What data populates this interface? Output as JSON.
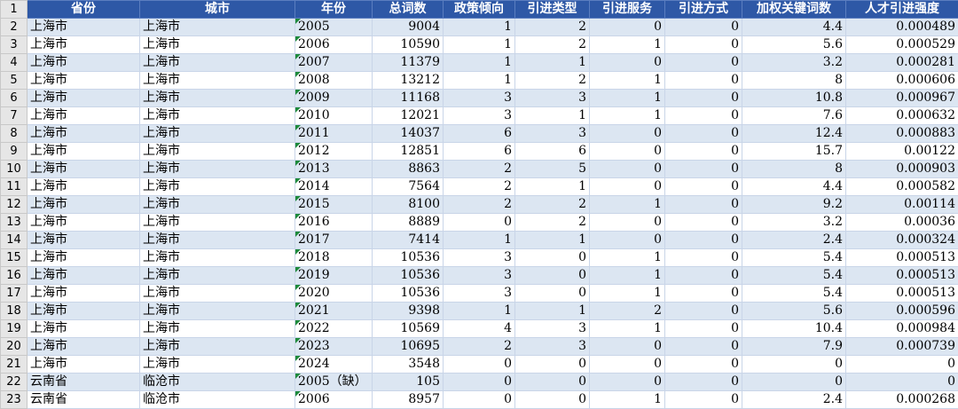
{
  "columns": [
    "省份",
    "城市",
    "年份",
    "总词数",
    "政策倾向",
    "引进类型",
    "引进服务",
    "引进方式",
    "加权关键词数",
    "人才引进强度"
  ],
  "header_row_number": "1",
  "rows": [
    {
      "n": "2",
      "province": "上海市",
      "city": "上海市",
      "year": "2005",
      "words": "9004",
      "tendency": "1",
      "type": "2",
      "service": "0",
      "method": "0",
      "weighted": "4.4",
      "intensity": "0.000489"
    },
    {
      "n": "3",
      "province": "上海市",
      "city": "上海市",
      "year": "2006",
      "words": "10590",
      "tendency": "1",
      "type": "2",
      "service": "1",
      "method": "0",
      "weighted": "5.6",
      "intensity": "0.000529"
    },
    {
      "n": "4",
      "province": "上海市",
      "city": "上海市",
      "year": "2007",
      "words": "11379",
      "tendency": "1",
      "type": "1",
      "service": "0",
      "method": "0",
      "weighted": "3.2",
      "intensity": "0.000281"
    },
    {
      "n": "5",
      "province": "上海市",
      "city": "上海市",
      "year": "2008",
      "words": "13212",
      "tendency": "1",
      "type": "2",
      "service": "1",
      "method": "0",
      "weighted": "8",
      "intensity": "0.000606"
    },
    {
      "n": "6",
      "province": "上海市",
      "city": "上海市",
      "year": "2009",
      "words": "11168",
      "tendency": "3",
      "type": "3",
      "service": "1",
      "method": "0",
      "weighted": "10.8",
      "intensity": "0.000967"
    },
    {
      "n": "7",
      "province": "上海市",
      "city": "上海市",
      "year": "2010",
      "words": "12021",
      "tendency": "3",
      "type": "1",
      "service": "1",
      "method": "0",
      "weighted": "7.6",
      "intensity": "0.000632"
    },
    {
      "n": "8",
      "province": "上海市",
      "city": "上海市",
      "year": "2011",
      "words": "14037",
      "tendency": "6",
      "type": "3",
      "service": "0",
      "method": "0",
      "weighted": "12.4",
      "intensity": "0.000883"
    },
    {
      "n": "9",
      "province": "上海市",
      "city": "上海市",
      "year": "2012",
      "words": "12851",
      "tendency": "6",
      "type": "6",
      "service": "0",
      "method": "0",
      "weighted": "15.7",
      "intensity": "0.00122"
    },
    {
      "n": "10",
      "province": "上海市",
      "city": "上海市",
      "year": "2013",
      "words": "8863",
      "tendency": "2",
      "type": "5",
      "service": "0",
      "method": "0",
      "weighted": "8",
      "intensity": "0.000903"
    },
    {
      "n": "11",
      "province": "上海市",
      "city": "上海市",
      "year": "2014",
      "words": "7564",
      "tendency": "2",
      "type": "1",
      "service": "0",
      "method": "0",
      "weighted": "4.4",
      "intensity": "0.000582"
    },
    {
      "n": "12",
      "province": "上海市",
      "city": "上海市",
      "year": "2015",
      "words": "8100",
      "tendency": "2",
      "type": "2",
      "service": "1",
      "method": "0",
      "weighted": "9.2",
      "intensity": "0.00114"
    },
    {
      "n": "13",
      "province": "上海市",
      "city": "上海市",
      "year": "2016",
      "words": "8889",
      "tendency": "0",
      "type": "2",
      "service": "0",
      "method": "0",
      "weighted": "3.2",
      "intensity": "0.00036"
    },
    {
      "n": "14",
      "province": "上海市",
      "city": "上海市",
      "year": "2017",
      "words": "7414",
      "tendency": "1",
      "type": "1",
      "service": "0",
      "method": "0",
      "weighted": "2.4",
      "intensity": "0.000324"
    },
    {
      "n": "15",
      "province": "上海市",
      "city": "上海市",
      "year": "2018",
      "words": "10536",
      "tendency": "3",
      "type": "0",
      "service": "1",
      "method": "0",
      "weighted": "5.4",
      "intensity": "0.000513"
    },
    {
      "n": "16",
      "province": "上海市",
      "city": "上海市",
      "year": "2019",
      "words": "10536",
      "tendency": "3",
      "type": "0",
      "service": "1",
      "method": "0",
      "weighted": "5.4",
      "intensity": "0.000513"
    },
    {
      "n": "17",
      "province": "上海市",
      "city": "上海市",
      "year": "2020",
      "words": "10536",
      "tendency": "3",
      "type": "0",
      "service": "1",
      "method": "0",
      "weighted": "5.4",
      "intensity": "0.000513"
    },
    {
      "n": "18",
      "province": "上海市",
      "city": "上海市",
      "year": "2021",
      "words": "9398",
      "tendency": "1",
      "type": "1",
      "service": "2",
      "method": "0",
      "weighted": "5.6",
      "intensity": "0.000596"
    },
    {
      "n": "19",
      "province": "上海市",
      "city": "上海市",
      "year": "2022",
      "words": "10569",
      "tendency": "4",
      "type": "3",
      "service": "1",
      "method": "0",
      "weighted": "10.4",
      "intensity": "0.000984"
    },
    {
      "n": "20",
      "province": "上海市",
      "city": "上海市",
      "year": "2023",
      "words": "10695",
      "tendency": "2",
      "type": "3",
      "service": "0",
      "method": "0",
      "weighted": "7.9",
      "intensity": "0.000739"
    },
    {
      "n": "21",
      "province": "上海市",
      "city": "上海市",
      "year": "2024",
      "words": "3548",
      "tendency": "0",
      "type": "0",
      "service": "0",
      "method": "0",
      "weighted": "0",
      "intensity": "0"
    },
    {
      "n": "22",
      "province": "云南省",
      "city": "临沧市",
      "year": "2005（缺）",
      "words": "105",
      "tendency": "0",
      "type": "0",
      "service": "0",
      "method": "0",
      "weighted": "0",
      "intensity": "0"
    },
    {
      "n": "23",
      "province": "云南省",
      "city": "临沧市",
      "year": "2006",
      "words": "8957",
      "tendency": "0",
      "type": "0",
      "service": "1",
      "method": "0",
      "weighted": "2.4",
      "intensity": "0.000268"
    }
  ]
}
